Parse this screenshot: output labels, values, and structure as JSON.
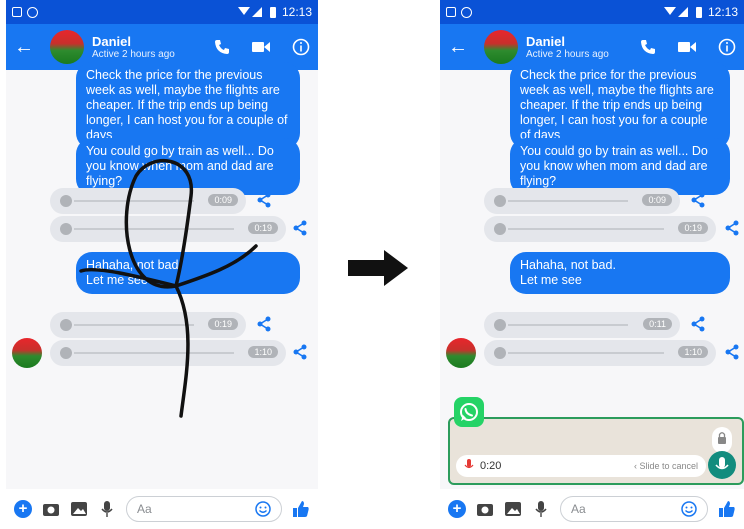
{
  "status": {
    "time": "12:13"
  },
  "contact": {
    "name": "Daniel",
    "status": "Active 2 hours ago"
  },
  "messages": {
    "m1": "Check the price for the previous week as well, maybe the flights are cheaper. If the trip ends up being longer, I can host you for a couple of days",
    "m2": "You could go by train as well... Do you know when mom and dad are flying?",
    "m3_line1": "Hahaha, not bad.",
    "m3_line2": "Let me see"
  },
  "left_voice": {
    "v1": "0:09",
    "v2": "0:19",
    "v3": "0:19",
    "v4": "1:10"
  },
  "right_voice": {
    "v1": "0:09",
    "v2": "0:19",
    "v3": "0:11",
    "v4": "1:10"
  },
  "composer": {
    "placeholder": "Aa"
  },
  "whatsapp": {
    "timer": "0:20",
    "slide_cancel": "Slide to cancel"
  },
  "colors": {
    "messenger_blue": "#1877f2",
    "statusbar": "#0a52d6",
    "whatsapp_green": "#25d366"
  }
}
